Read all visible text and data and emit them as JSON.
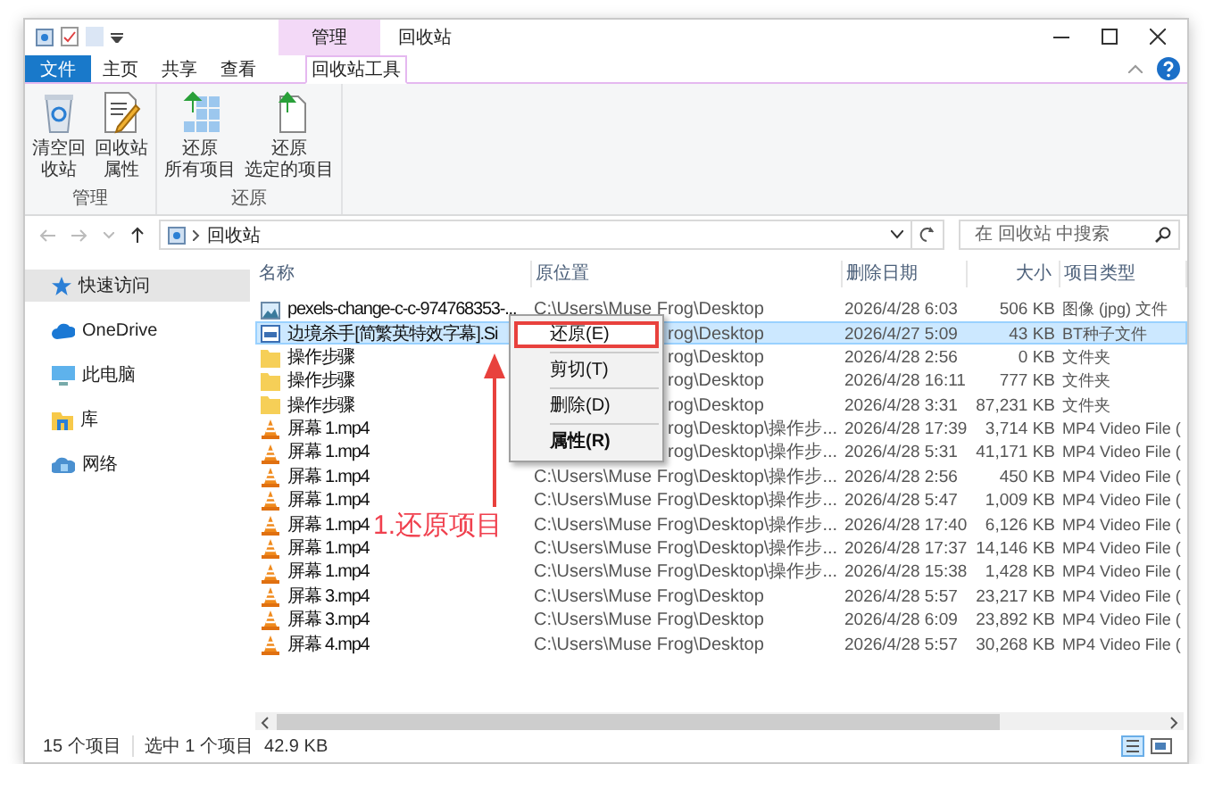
{
  "title_bar": {
    "context_tab": "管理",
    "title": "回收站"
  },
  "ribbon_tabs": [
    {
      "label": "文件",
      "kind": "file",
      "selected": false
    },
    {
      "label": "主页",
      "kind": "plain",
      "selected": false
    },
    {
      "label": "共享",
      "kind": "plain",
      "selected": false
    },
    {
      "label": "查看",
      "kind": "plain",
      "selected": false
    },
    {
      "label": "回收站工具",
      "kind": "context",
      "selected": true
    }
  ],
  "ribbon_groups": [
    {
      "label": "管理",
      "buttons": [
        {
          "lines": [
            "清空回",
            "收站"
          ]
        },
        {
          "lines": [
            "回收站",
            "属性"
          ]
        }
      ]
    },
    {
      "label": "还原",
      "buttons": [
        {
          "lines": [
            "还原",
            "所有项目"
          ]
        },
        {
          "lines": [
            "还原",
            "选定的项目"
          ]
        }
      ]
    }
  ],
  "address": {
    "path": "回收站"
  },
  "search": {
    "placeholder": "在 回收站 中搜索"
  },
  "nav_pane": [
    {
      "label": "快速访问",
      "selected": true
    },
    {
      "label": "OneDrive",
      "selected": false
    },
    {
      "label": "此电脑",
      "selected": false
    },
    {
      "label": "库",
      "selected": false
    },
    {
      "label": "网络",
      "selected": false
    }
  ],
  "columns": [
    "名称",
    "原位置",
    "删除日期",
    "大小",
    "项目类型"
  ],
  "rows": [
    {
      "kind": "image",
      "name": "pexels-change-c-c-974768353-...",
      "location": "C:\\Users\\Muse Frog\\Desktop",
      "date": "2026/4/28 6:03",
      "size": "506 KB",
      "type": "图像 (jpg) 文件",
      "selected": false
    },
    {
      "kind": "torrent",
      "name": "边境杀手[简繁英特效字幕].Si",
      "location": "rog\\Desktop",
      "date": "2026/4/27 5:09",
      "size": "43 KB",
      "type": "BT种子文件",
      "selected": true
    },
    {
      "kind": "folder",
      "name": "操作步骤",
      "location": "rog\\Desktop",
      "date": "2026/4/28 2:56",
      "size": "0 KB",
      "type": "文件夹",
      "selected": false
    },
    {
      "kind": "folder",
      "name": "操作步骤",
      "location": "rog\\Desktop",
      "date": "2026/4/28 16:11",
      "size": "777 KB",
      "type": "文件夹",
      "selected": false
    },
    {
      "kind": "folder",
      "name": "操作步骤",
      "location": "rog\\Desktop",
      "date": "2026/4/28 3:31",
      "size": "87,231 KB",
      "type": "文件夹",
      "selected": false
    },
    {
      "kind": "video",
      "name": "屏幕 1.mp4",
      "location": "rog\\Desktop\\操作步...",
      "date": "2026/4/28 17:39",
      "size": "3,714 KB",
      "type": "MP4 Video File (",
      "selected": false
    },
    {
      "kind": "video",
      "name": "屏幕 1.mp4",
      "location": "rog\\Desktop\\操作步...",
      "date": "2026/4/28 5:31",
      "size": "41,171 KB",
      "type": "MP4 Video File (",
      "selected": false
    },
    {
      "kind": "video",
      "name": "屏幕 1.mp4",
      "location": "C:\\Users\\Muse Frog\\Desktop\\操作步...",
      "date": "2026/4/28 2:56",
      "size": "450 KB",
      "type": "MP4 Video File (",
      "selected": false
    },
    {
      "kind": "video",
      "name": "屏幕 1.mp4",
      "location": "C:\\Users\\Muse Frog\\Desktop\\操作步...",
      "date": "2026/4/28 5:47",
      "size": "1,009 KB",
      "type": "MP4 Video File (",
      "selected": false
    },
    {
      "kind": "video",
      "name": "屏幕 1.mp4",
      "location": "C:\\Users\\Muse Frog\\Desktop\\操作步...",
      "date": "2026/4/28 17:40",
      "size": "6,126 KB",
      "type": "MP4 Video File (",
      "selected": false
    },
    {
      "kind": "video",
      "name": "屏幕 1.mp4",
      "location": "C:\\Users\\Muse Frog\\Desktop\\操作步...",
      "date": "2026/4/28 17:37",
      "size": "14,146 KB",
      "type": "MP4 Video File (",
      "selected": false
    },
    {
      "kind": "video",
      "name": "屏幕 1.mp4",
      "location": "C:\\Users\\Muse Frog\\Desktop\\操作步...",
      "date": "2026/4/28 15:38",
      "size": "1,428 KB",
      "type": "MP4 Video File (",
      "selected": false
    },
    {
      "kind": "video",
      "name": "屏幕 3.mp4",
      "location": "C:\\Users\\Muse Frog\\Desktop",
      "date": "2026/4/28 5:57",
      "size": "23,217 KB",
      "type": "MP4 Video File (",
      "selected": false
    },
    {
      "kind": "video",
      "name": "屏幕 3.mp4",
      "location": "C:\\Users\\Muse Frog\\Desktop",
      "date": "2026/4/28 6:09",
      "size": "23,892 KB",
      "type": "MP4 Video File (",
      "selected": false
    },
    {
      "kind": "video",
      "name": "屏幕 4.mp4",
      "location": "C:\\Users\\Muse Frog\\Desktop",
      "date": "2026/4/28 5:57",
      "size": "30,268 KB",
      "type": "MP4 Video File (",
      "selected": false
    }
  ],
  "context_menu": {
    "items": [
      {
        "label": "还原(E)",
        "highlighted": true,
        "default": false
      },
      {
        "label": "剪切(T)",
        "highlighted": false,
        "default": false
      },
      {
        "label": "删除(D)",
        "highlighted": false,
        "default": false
      },
      {
        "label": "属性(R)",
        "highlighted": false,
        "default": true
      }
    ]
  },
  "annotation": {
    "label": "1.还原项目"
  },
  "status_bar": {
    "count": "15 个项目",
    "selection": "选中 1 个项目",
    "size": "42.9 KB"
  }
}
